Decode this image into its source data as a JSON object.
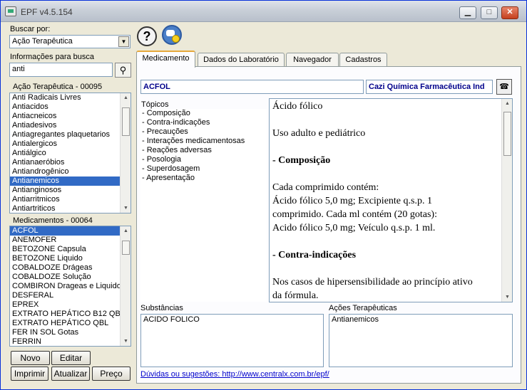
{
  "window": {
    "title": "EPF v4.5.154"
  },
  "left": {
    "search_by_label": "Buscar por:",
    "search_by_value": "Ação Terapêutica",
    "info_label": "Informações para busca",
    "search_value": "anti",
    "acoes_header": "Ação Terapêutica - 00095",
    "acoes": [
      "Anti Radicais Livres",
      "Antiacidos",
      "Antiacneicos",
      "Antiadesivos",
      "Antiagregantes plaquetarios",
      "Antialergicos",
      "Antiálgico",
      "Antianaeróbios",
      "Antiandrogênico",
      "Antianemicos",
      "Antianginosos",
      "Antiarritmicos",
      "Antiartriticos"
    ],
    "acoes_selected": "Antianemicos",
    "med_header": "Medicamentos - 00064",
    "medicamentos": [
      "ACFOL",
      "ANEMOFER",
      "BETOZONE Capsula",
      "BETOZONE Liquido",
      "COBALDOZE Drágeas",
      "COBALDOZE Solução",
      "COMBIRON Drageas e Liquido",
      "DESFERAL",
      "EPREX",
      "EXTRATO HEPÁTICO B12 QB",
      "EXTRATO HEPÁTICO QBL",
      "FER IN SOL Gotas",
      "FERRIN"
    ],
    "med_selected": "ACFOL",
    "buttons": {
      "novo": "Novo",
      "editar": "Editar",
      "imprimir": "Imprimir",
      "atualizar": "Atualizar",
      "preco": "Preço"
    }
  },
  "toolbar": {
    "help_icon": "?"
  },
  "tabs": [
    "Medicamento",
    "Dados do Laboratório",
    "Navegador",
    "Cadastros"
  ],
  "medicamento": {
    "name": "ACFOL",
    "laboratorio": "Cazi Química Farmacêutica Ind",
    "topicos_label": "Tópicos",
    "topicos": [
      "- Composição",
      "- Contra-indicações",
      "- Precauções",
      "- Interações medicamentosas",
      "- Reações adversas",
      "- Posologia",
      "- Superdosagem",
      "- Apresentação"
    ],
    "document": [
      {
        "t": "Ácido fólico",
        "b": false
      },
      {
        "t": "",
        "b": false
      },
      {
        "t": "Uso adulto e pediátrico",
        "b": false
      },
      {
        "t": "",
        "b": false
      },
      {
        "t": "- Composição",
        "b": true
      },
      {
        "t": "",
        "b": false
      },
      {
        "t": "Cada comprimido contém:",
        "b": false
      },
      {
        "t": "Ácido fólico 5,0 mg; Excipiente q.s.p. 1",
        "b": false
      },
      {
        "t": "comprimido. Cada ml contém (20 gotas):",
        "b": false
      },
      {
        "t": "Acido fólico 5,0 mg; Veículo q.s.p. 1 ml.",
        "b": false
      },
      {
        "t": "",
        "b": false
      },
      {
        "t": "- Contra-indicações",
        "b": true
      },
      {
        "t": "",
        "b": false
      },
      {
        "t": "Nos casos de hipersensibilidade ao princípio ativo",
        "b": false
      },
      {
        "t": "da fórmula.",
        "b": false
      }
    ],
    "substancias_label": "Substâncias",
    "substancias": [
      "ACIDO FOLICO"
    ],
    "acoes_label": "Ações Terapêuticas",
    "acoes": [
      "Antianemicos"
    ],
    "footer_link": "Dúvidas ou sugestões: http://www.centralx.com.br/epf/"
  }
}
